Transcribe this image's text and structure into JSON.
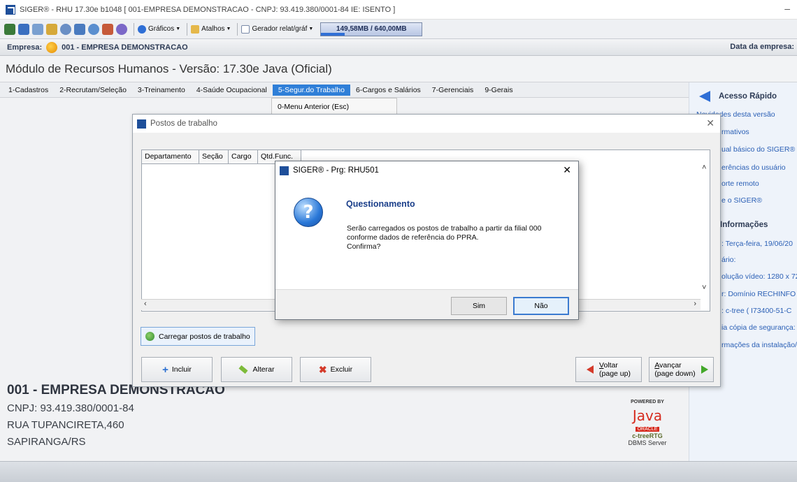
{
  "window": {
    "title": "SIGER® - RHU 17.30e b1048 [ 001-EMPRESA DEMONSTRACAO - CNPJ: 93.419.380/0001-84 IE: ISENTO ]",
    "min_symbol": "–"
  },
  "toolbar": {
    "graficos": "Gráficos",
    "atalhos": "Atalhos",
    "gerador": "Gerador relat/gráf",
    "memory": "149,58MB / 640,00MB",
    "memory_used_fraction": 0.234
  },
  "empresa_bar": {
    "label": "Empresa:",
    "value": "001 - EMPRESA DEMONSTRACAO",
    "data_label": "Data da empresa:"
  },
  "module_title": "Módulo de Recursos Humanos - Versão: 17.30e Java (Oficial)",
  "menu": [
    "1-Cadastros",
    "2-Recrutam/Seleção",
    "3-Treinamento",
    "4-Saúde Ocupacional",
    "5-Segur.do Trabalho",
    "6-Cargos e Salários",
    "7-Gerenciais",
    "9-Gerais"
  ],
  "dropdown_item": "0-Menu Anterior (Esc)",
  "right_panel": {
    "acesso_rapido": "Acesso Rápido",
    "links": [
      "Novidades desta versão",
      "rmativos",
      "ual básico do SIGER®",
      "erências do usuário",
      "orte remoto",
      "e o SIGER®"
    ],
    "informacoes": "Informações",
    "info_items": [
      ": Terça-feira, 19/06/20",
      "ário:",
      "olução vídeo: 1280 x 72",
      "r: Domínio RECHINFO (",
      ": c-tree ( I73400-51-C",
      "ia cópia de segurança:",
      "rmações da instalação/a"
    ]
  },
  "company": {
    "name": "001 - EMPRESA DEMONSTRACAO",
    "cnpj": "CNPJ: 93.419.380/0001-84",
    "street": "RUA TUPANCIRETA,460",
    "city": "SAPIRANGA/RS"
  },
  "powered": {
    "by": "POWERED BY",
    "java": "Java",
    "oracle": "ORACLE",
    "ctree": "c-treeRTG",
    "dbms": "DBMS Server"
  },
  "postos": {
    "title": "Postos de trabalho",
    "columns": [
      "Departamento",
      "Seção",
      "Cargo",
      "Qtd.Func."
    ],
    "carregar": "Carregar postos de trabalho",
    "incluir": "Incluir",
    "alterar": "Alterar",
    "excluir": "Excluir",
    "voltar_1": "Voltar",
    "voltar_2": "(page up)",
    "avancar_1": "Avançar",
    "avancar_2": "(page down)"
  },
  "dialog": {
    "title": "SIGER® - Prg: RHU501",
    "heading": "Questionamento",
    "line1": "Serão carregados os postos de trabalho a partir da filial 000",
    "line2": "conforme dados de referência do PPRA.",
    "line3": "Confirma?",
    "sim": "Sim",
    "nao": "Não",
    "icon_glyph": "?"
  }
}
